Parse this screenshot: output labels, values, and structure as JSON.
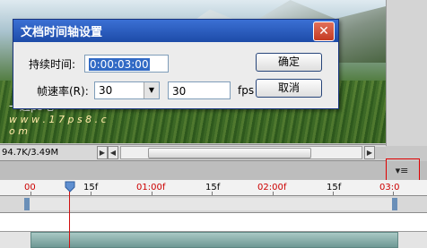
{
  "dialog": {
    "title": "文档时间轴设置",
    "duration_label": "持续时间:",
    "duration_value": "0:00:03:00",
    "framerate_label": "帧速率(R):",
    "framerate_select": "30",
    "framerate_value": "30",
    "fps_unit": "fps",
    "ok_label": "确定",
    "cancel_label": "取消"
  },
  "watermark": {
    "line1": "一起ps吧",
    "line2": "w w w . 1 7 p s 8 . c o m"
  },
  "status": {
    "doc_size": "94.7K/3.49M"
  },
  "timeline": {
    "ticks": [
      {
        "label": "00",
        "color": "#cc0000"
      },
      {
        "label": "15f",
        "color": "#000000"
      },
      {
        "label": "01:00f",
        "color": "#cc0000"
      },
      {
        "label": "15f",
        "color": "#000000"
      },
      {
        "label": "02:00f",
        "color": "#cc0000"
      },
      {
        "label": "15f",
        "color": "#000000"
      },
      {
        "label": "03:0",
        "color": "#cc0000"
      }
    ]
  },
  "colors": {
    "title_bar": "#2459bf",
    "highlight": "#cc0000",
    "layer_bar": "#8fb3af"
  }
}
